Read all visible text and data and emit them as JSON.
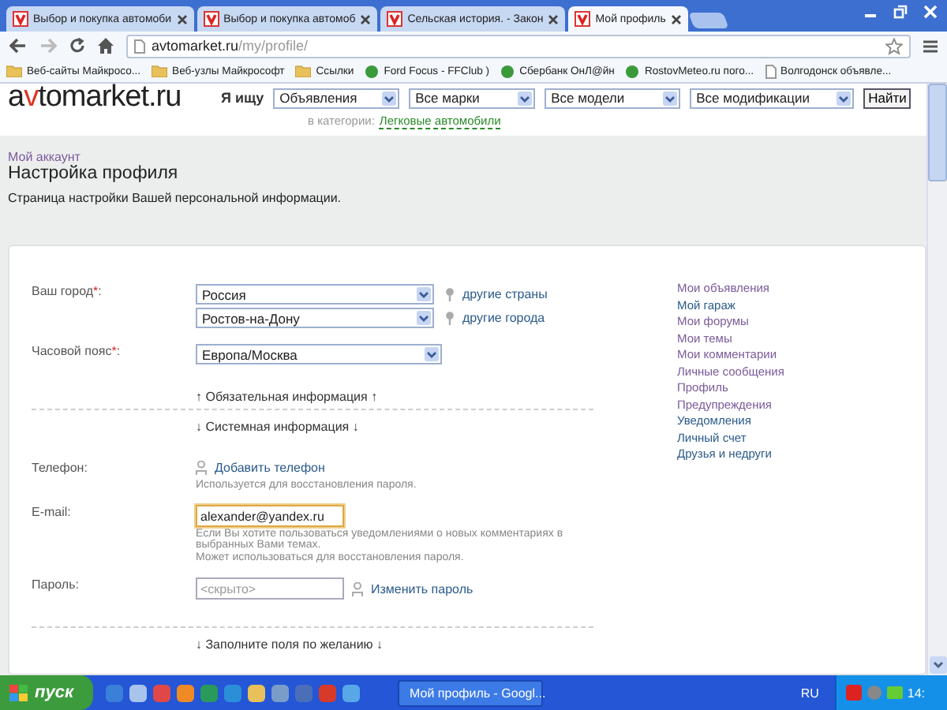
{
  "browser": {
    "tabs": [
      {
        "title": "Выбор и покупка автомоби",
        "selected": false
      },
      {
        "title": "Выбор и покупка автомоб",
        "selected": false
      },
      {
        "title": "Сельская история. - Закон",
        "selected": false
      },
      {
        "title": "Мой профиль",
        "selected": true
      }
    ],
    "address": {
      "host": "avtomarket.ru",
      "path": "/my/profile/"
    },
    "bookmarks": [
      {
        "label": "Веб-сайты Майкросо...",
        "kind": "folder"
      },
      {
        "label": "Веб-узлы Майкрософт",
        "kind": "folder"
      },
      {
        "label": "Ссылки",
        "kind": "folder"
      },
      {
        "label": "Ford Focus - FFClub )",
        "kind": "site"
      },
      {
        "label": "Сбербанк ОнЛ@йн",
        "kind": "site"
      },
      {
        "label": "RostovMeteo.ru пого...",
        "kind": "site"
      },
      {
        "label": "Волгодонск объявле...",
        "kind": "page"
      }
    ]
  },
  "site_header": {
    "logo": {
      "start": "a",
      "accent": "v",
      "end": "tomarket.ru"
    },
    "search_label": "Я ищу",
    "selects": [
      {
        "value": "Объявления"
      },
      {
        "value": "Все марки"
      },
      {
        "value": "Все модели"
      },
      {
        "value": "Все модификации"
      }
    ],
    "search_button": "Найти",
    "category_label": "в категории:",
    "category_link": "Легковые автомобили"
  },
  "page": {
    "breadcrumb": "Мой аккаунт",
    "title": "Настройка профиля",
    "description": "Страница настройки Вашей персональной информации."
  },
  "form": {
    "rows": [
      {
        "kind": "selects",
        "label": "Ваш город",
        "required_mark": "*",
        "label_end": ":",
        "selects": [
          {
            "value": "Россия",
            "link": "другие страны"
          },
          {
            "value": "Ростов-на-Дону",
            "link": "другие города"
          }
        ]
      },
      {
        "kind": "selects",
        "label": "Часовой пояс",
        "required_mark": "*",
        "label_end": ":",
        "selects": [
          {
            "value": "Европа/Москва"
          }
        ]
      },
      {
        "kind": "toggle",
        "text": "↑ Обязательная информация ↑"
      },
      {
        "kind": "rule"
      },
      {
        "kind": "toggle",
        "text": "↓ Системная информация ↓"
      },
      {
        "kind": "link",
        "label": "Телефон:",
        "link": "Добавить телефон",
        "hints": [
          "Используется для восстановления пароля."
        ]
      },
      {
        "kind": "input",
        "label": "E-mail:",
        "value": "alexander@yandex.ru",
        "focused": true,
        "hints": [
          "Если Вы хотите пользоваться уведомлениями о новых комментариях в выбранных Вами темах.",
          "Может использоваться для восстановления пароля."
        ]
      },
      {
        "kind": "password",
        "label": "Пароль:",
        "placeholder": "<скрыто>",
        "link": "Изменить пароль"
      },
      {
        "kind": "rule"
      },
      {
        "kind": "toggle",
        "text": "↓ Заполните поля по желанию ↓"
      }
    ]
  },
  "account_menu": [
    {
      "label": "Мои объявления",
      "visited": true
    },
    {
      "label": "Мой гараж",
      "visited": false
    },
    {
      "label": "Мои форумы",
      "visited": true
    },
    {
      "label": "Мои темы",
      "visited": true
    },
    {
      "label": "Мои комментарии",
      "visited": true
    },
    {
      "label": "Личные сообщения",
      "visited": true
    },
    {
      "label": "Профиль",
      "visited": true
    },
    {
      "label": "Предупреждения",
      "visited": true
    },
    {
      "label": "Уведомления",
      "visited": false
    },
    {
      "label": "Личный счет",
      "visited": false
    },
    {
      "label": "Друзья и недруги",
      "visited": false
    }
  ],
  "taskbar": {
    "start": "пуск",
    "tasks": [
      {
        "title": "Мой профиль - Googl..."
      }
    ],
    "language": "RU",
    "clock": "14:"
  }
}
